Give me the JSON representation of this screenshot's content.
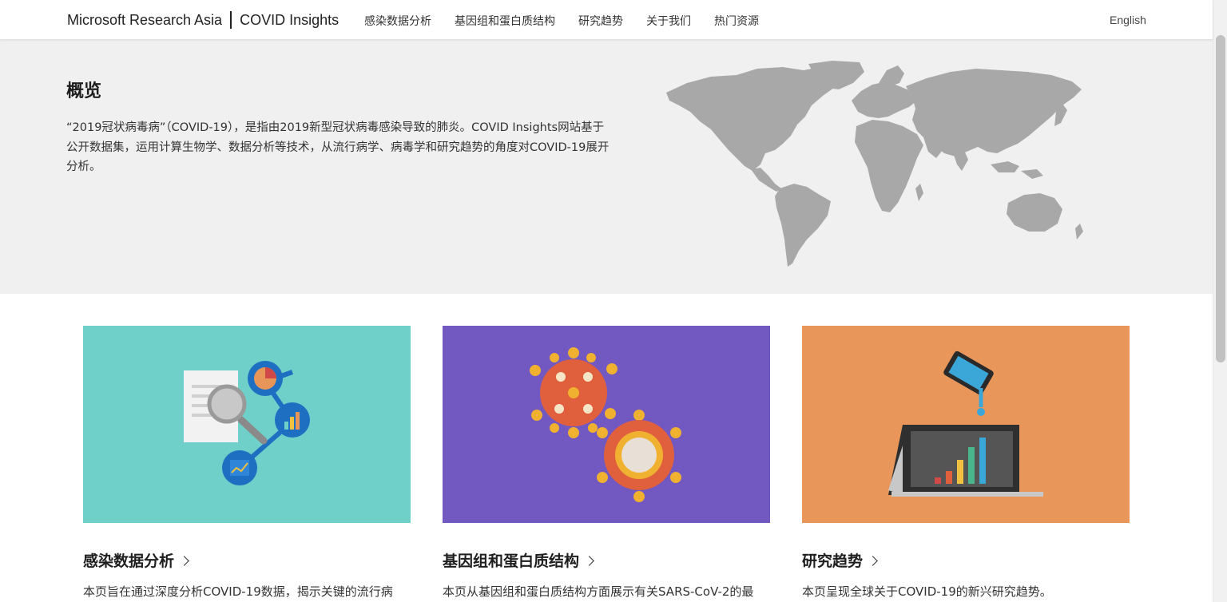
{
  "header": {
    "org": "Microsoft Research Asia",
    "product": "COVID Insights",
    "nav": [
      {
        "label": "感染数据分析"
      },
      {
        "label": "基因组和蛋白质结构"
      },
      {
        "label": "研究趋势"
      },
      {
        "label": "关于我们"
      },
      {
        "label": "热门资源"
      }
    ],
    "language": "English"
  },
  "hero": {
    "title": "概览",
    "description": "“2019冠状病毒病”（COVID-19），是指由2019新型冠状病毒感染导致的肺炎。COVID Insights网站基于公开数据集，运用计算生物学、数据分析等技术，从流行病学、病毒学和研究趋势的角度对COVID-19展开分析。"
  },
  "cards": [
    {
      "title": "感染数据分析",
      "description": "本页旨在通过深度分析COVID-19数据，揭示关键的流行病",
      "bg": "#6fd0c9",
      "icon": "data-analysis-illustration"
    },
    {
      "title": "基因组和蛋白质结构",
      "description": "本页从基因组和蛋白质结构方面展示有关SARS-CoV-2的最",
      "bg": "#7159c1",
      "icon": "virus-illustration"
    },
    {
      "title": "研究趋势",
      "description": "本页呈现全球关于COVID-19的新兴研究趋势。",
      "bg": "#e8965a",
      "icon": "research-trend-illustration"
    }
  ],
  "colors": {
    "hero_bg": "#f0f0f0",
    "map_gray": "#a8a8a8",
    "text": "#222222"
  }
}
